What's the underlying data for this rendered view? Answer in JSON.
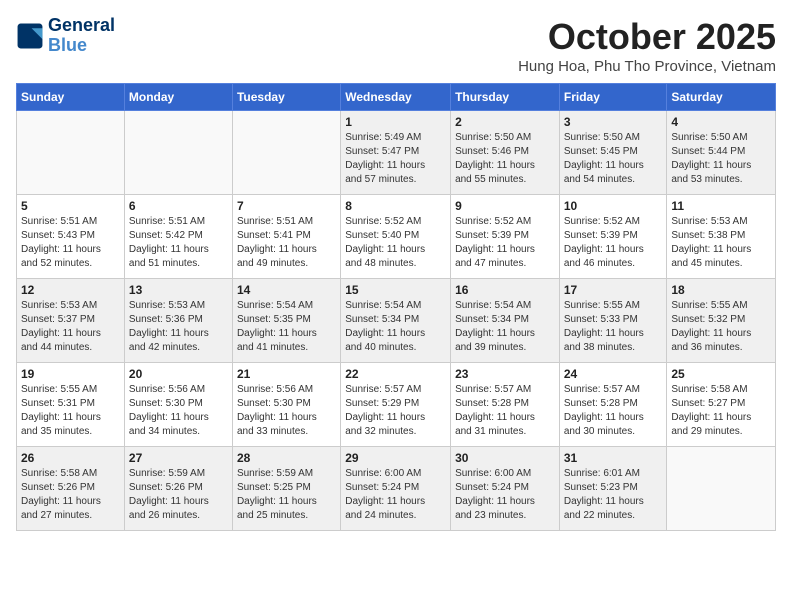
{
  "header": {
    "logo_line1": "General",
    "logo_line2": "Blue",
    "month_title": "October 2025",
    "subtitle": "Hung Hoa, Phu Tho Province, Vietnam"
  },
  "weekdays": [
    "Sunday",
    "Monday",
    "Tuesday",
    "Wednesday",
    "Thursday",
    "Friday",
    "Saturday"
  ],
  "weeks": [
    [
      {
        "day": "",
        "info": ""
      },
      {
        "day": "",
        "info": ""
      },
      {
        "day": "",
        "info": ""
      },
      {
        "day": "1",
        "info": "Sunrise: 5:49 AM\nSunset: 5:47 PM\nDaylight: 11 hours\nand 57 minutes."
      },
      {
        "day": "2",
        "info": "Sunrise: 5:50 AM\nSunset: 5:46 PM\nDaylight: 11 hours\nand 55 minutes."
      },
      {
        "day": "3",
        "info": "Sunrise: 5:50 AM\nSunset: 5:45 PM\nDaylight: 11 hours\nand 54 minutes."
      },
      {
        "day": "4",
        "info": "Sunrise: 5:50 AM\nSunset: 5:44 PM\nDaylight: 11 hours\nand 53 minutes."
      }
    ],
    [
      {
        "day": "5",
        "info": "Sunrise: 5:51 AM\nSunset: 5:43 PM\nDaylight: 11 hours\nand 52 minutes."
      },
      {
        "day": "6",
        "info": "Sunrise: 5:51 AM\nSunset: 5:42 PM\nDaylight: 11 hours\nand 51 minutes."
      },
      {
        "day": "7",
        "info": "Sunrise: 5:51 AM\nSunset: 5:41 PM\nDaylight: 11 hours\nand 49 minutes."
      },
      {
        "day": "8",
        "info": "Sunrise: 5:52 AM\nSunset: 5:40 PM\nDaylight: 11 hours\nand 48 minutes."
      },
      {
        "day": "9",
        "info": "Sunrise: 5:52 AM\nSunset: 5:39 PM\nDaylight: 11 hours\nand 47 minutes."
      },
      {
        "day": "10",
        "info": "Sunrise: 5:52 AM\nSunset: 5:39 PM\nDaylight: 11 hours\nand 46 minutes."
      },
      {
        "day": "11",
        "info": "Sunrise: 5:53 AM\nSunset: 5:38 PM\nDaylight: 11 hours\nand 45 minutes."
      }
    ],
    [
      {
        "day": "12",
        "info": "Sunrise: 5:53 AM\nSunset: 5:37 PM\nDaylight: 11 hours\nand 44 minutes."
      },
      {
        "day": "13",
        "info": "Sunrise: 5:53 AM\nSunset: 5:36 PM\nDaylight: 11 hours\nand 42 minutes."
      },
      {
        "day": "14",
        "info": "Sunrise: 5:54 AM\nSunset: 5:35 PM\nDaylight: 11 hours\nand 41 minutes."
      },
      {
        "day": "15",
        "info": "Sunrise: 5:54 AM\nSunset: 5:34 PM\nDaylight: 11 hours\nand 40 minutes."
      },
      {
        "day": "16",
        "info": "Sunrise: 5:54 AM\nSunset: 5:34 PM\nDaylight: 11 hours\nand 39 minutes."
      },
      {
        "day": "17",
        "info": "Sunrise: 5:55 AM\nSunset: 5:33 PM\nDaylight: 11 hours\nand 38 minutes."
      },
      {
        "day": "18",
        "info": "Sunrise: 5:55 AM\nSunset: 5:32 PM\nDaylight: 11 hours\nand 36 minutes."
      }
    ],
    [
      {
        "day": "19",
        "info": "Sunrise: 5:55 AM\nSunset: 5:31 PM\nDaylight: 11 hours\nand 35 minutes."
      },
      {
        "day": "20",
        "info": "Sunrise: 5:56 AM\nSunset: 5:30 PM\nDaylight: 11 hours\nand 34 minutes."
      },
      {
        "day": "21",
        "info": "Sunrise: 5:56 AM\nSunset: 5:30 PM\nDaylight: 11 hours\nand 33 minutes."
      },
      {
        "day": "22",
        "info": "Sunrise: 5:57 AM\nSunset: 5:29 PM\nDaylight: 11 hours\nand 32 minutes."
      },
      {
        "day": "23",
        "info": "Sunrise: 5:57 AM\nSunset: 5:28 PM\nDaylight: 11 hours\nand 31 minutes."
      },
      {
        "day": "24",
        "info": "Sunrise: 5:57 AM\nSunset: 5:28 PM\nDaylight: 11 hours\nand 30 minutes."
      },
      {
        "day": "25",
        "info": "Sunrise: 5:58 AM\nSunset: 5:27 PM\nDaylight: 11 hours\nand 29 minutes."
      }
    ],
    [
      {
        "day": "26",
        "info": "Sunrise: 5:58 AM\nSunset: 5:26 PM\nDaylight: 11 hours\nand 27 minutes."
      },
      {
        "day": "27",
        "info": "Sunrise: 5:59 AM\nSunset: 5:26 PM\nDaylight: 11 hours\nand 26 minutes."
      },
      {
        "day": "28",
        "info": "Sunrise: 5:59 AM\nSunset: 5:25 PM\nDaylight: 11 hours\nand 25 minutes."
      },
      {
        "day": "29",
        "info": "Sunrise: 6:00 AM\nSunset: 5:24 PM\nDaylight: 11 hours\nand 24 minutes."
      },
      {
        "day": "30",
        "info": "Sunrise: 6:00 AM\nSunset: 5:24 PM\nDaylight: 11 hours\nand 23 minutes."
      },
      {
        "day": "31",
        "info": "Sunrise: 6:01 AM\nSunset: 5:23 PM\nDaylight: 11 hours\nand 22 minutes."
      },
      {
        "day": "",
        "info": ""
      }
    ]
  ]
}
